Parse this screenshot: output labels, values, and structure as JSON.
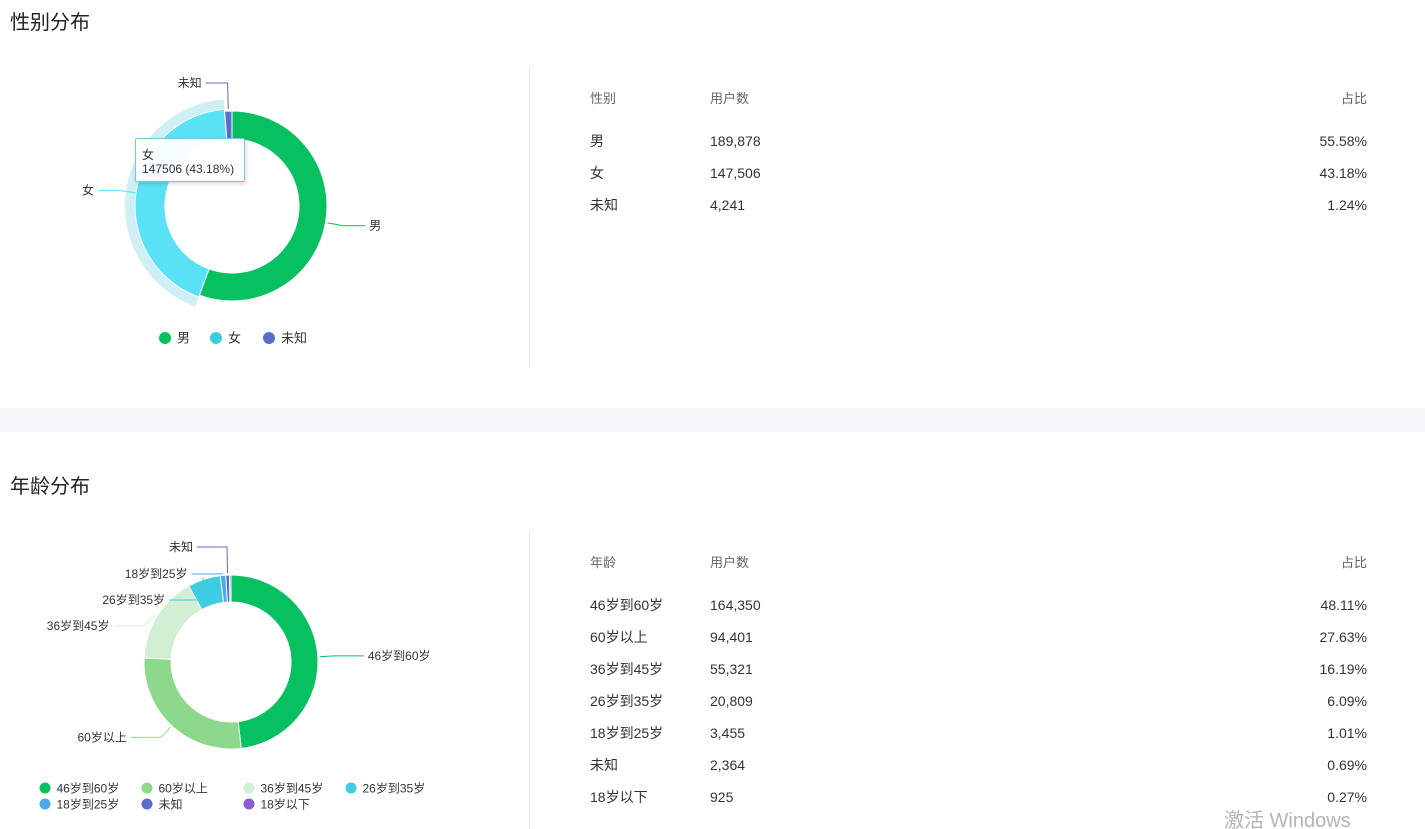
{
  "gender": {
    "title": "性别分布",
    "table": {
      "headers": [
        "性别",
        "用户数",
        "占比"
      ],
      "rows": [
        {
          "label": "男",
          "count": "189,878",
          "pct": "55.58%"
        },
        {
          "label": "女",
          "count": "147,506",
          "pct": "43.18%"
        },
        {
          "label": "未知",
          "count": "4,241",
          "pct": "1.24%"
        }
      ]
    },
    "tooltip": {
      "title": "女",
      "value": "147506 (43.18%)"
    },
    "chart_data": {
      "type": "pie",
      "variant": "donut",
      "categories": [
        "男",
        "女",
        "未知"
      ],
      "values": [
        189878,
        147506,
        4241
      ],
      "percentages": [
        55.58,
        43.18,
        1.24
      ],
      "colors": [
        "#07c160",
        "#59e1f5",
        "#5b6ccf"
      ],
      "legend_colors": [
        "#07c160",
        "#3ccde0",
        "#5b6ccf"
      ],
      "highlighted": "女",
      "highlight_halo_color": "#cdeff5",
      "legend_position": "bottom"
    }
  },
  "age": {
    "title": "年龄分布",
    "table": {
      "headers": [
        "年龄",
        "用户数",
        "占比"
      ],
      "rows": [
        {
          "label": "46岁到60岁",
          "count": "164,350",
          "pct": "48.11%"
        },
        {
          "label": "60岁以上",
          "count": "94,401",
          "pct": "27.63%"
        },
        {
          "label": "36岁到45岁",
          "count": "55,321",
          "pct": "16.19%"
        },
        {
          "label": "26岁到35岁",
          "count": "20,809",
          "pct": "6.09%"
        },
        {
          "label": "18岁到25岁",
          "count": "3,455",
          "pct": "1.01%"
        },
        {
          "label": "未知",
          "count": "2,364",
          "pct": "0.69%"
        },
        {
          "label": "18岁以下",
          "count": "925",
          "pct": "0.27%"
        }
      ]
    },
    "chart_data": {
      "type": "pie",
      "variant": "donut",
      "categories": [
        "46岁到60岁",
        "60岁以上",
        "36岁到45岁",
        "26岁到35岁",
        "18岁到25岁",
        "未知",
        "18岁以下"
      ],
      "values": [
        164350,
        94401,
        55321,
        20809,
        3455,
        2364,
        925
      ],
      "percentages": [
        48.11,
        27.63,
        16.19,
        6.09,
        1.01,
        0.69,
        0.27
      ],
      "colors": [
        "#07c160",
        "#8dd98c",
        "#d2efd4",
        "#3ccde0",
        "#4da9ee",
        "#5b6ccf",
        "#8c5dd0"
      ],
      "labeled_slices": [
        "46岁到60岁",
        "60岁以上",
        "36岁到45岁",
        "26岁到35岁",
        "18岁到25岁",
        "未知"
      ],
      "legend_position": "bottom"
    }
  },
  "watermark": "激活 Windows"
}
